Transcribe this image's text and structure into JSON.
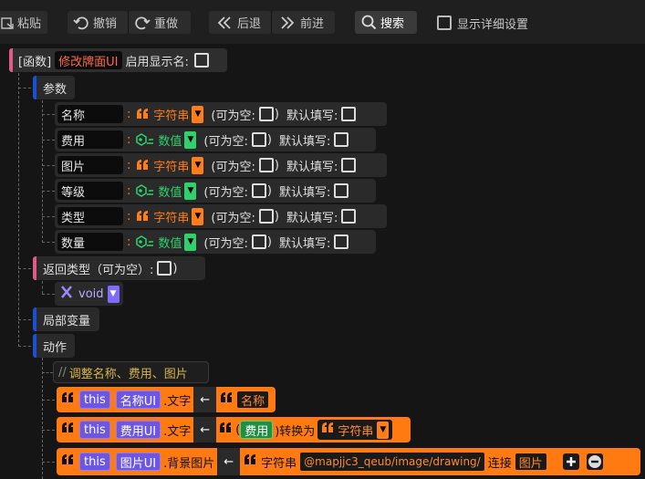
{
  "toolbar": {
    "paste": "粘贴",
    "undo": "撤销",
    "redo": "重做",
    "back": "后退",
    "forward": "前进",
    "search": "搜索",
    "show_details": "显示详细设置"
  },
  "function": {
    "tag": "[函数]",
    "name": "修改牌面UI",
    "enable_display_name": "启用显示名:"
  },
  "params_section": "参数",
  "params": [
    {
      "name": "名称",
      "type": "字符串",
      "kind": "string"
    },
    {
      "name": "费用",
      "type": "数值",
      "kind": "number"
    },
    {
      "name": "图片",
      "type": "字符串",
      "kind": "string"
    },
    {
      "name": "等级",
      "type": "数值",
      "kind": "number"
    },
    {
      "name": "类型",
      "type": "字符串",
      "kind": "string"
    },
    {
      "name": "数量",
      "type": "数值",
      "kind": "number"
    }
  ],
  "param_labels": {
    "colon": ":",
    "nullable_open": "(可为空:",
    "nullable_close": ")",
    "default_fill": "默认填写:"
  },
  "return_type": {
    "label": "返回类型（可为空）:",
    "close": ")",
    "value": "void"
  },
  "local_vars": "局部变量",
  "actions_section": "动作",
  "actions": {
    "comment_prefix": "//",
    "comment": "调整名称、费用、图片",
    "this": "this",
    "name_ui": "名称UI",
    "text_prop": ".文字",
    "arrow": "←",
    "name_var": "名称",
    "cost_ui": "费用UI",
    "open_paren": "(",
    "cost_var": "费用",
    "convert_to": ")转换为",
    "string_type": "字符串",
    "image_ui": "图片UI",
    "bg_prop": ".背景图片",
    "string_label": "字符串",
    "path": "@mapjjc3_qeub/image/drawing/",
    "concat": "连接",
    "image_var": "图片"
  },
  "colors": {
    "string": "#ff7d1a",
    "number": "#2ed16b",
    "purple": "#6d56e0",
    "section_bar_blue": "#1a4fd6",
    "section_bar_pink": "#e05a8a"
  }
}
